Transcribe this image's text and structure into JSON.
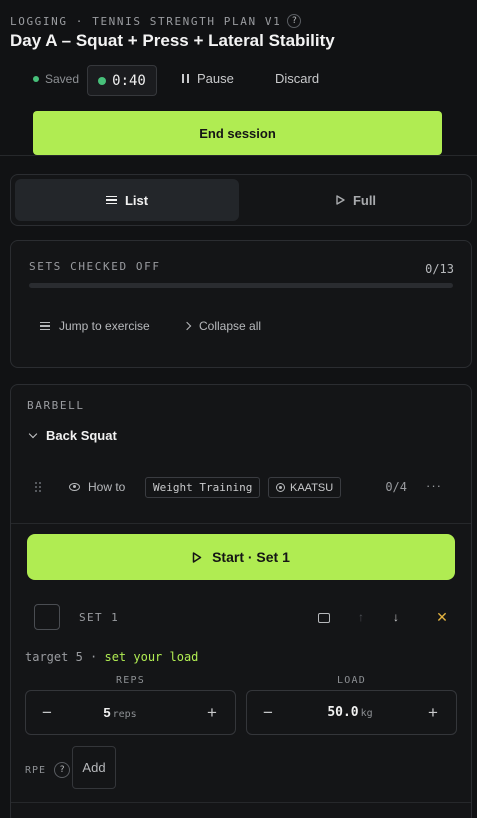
{
  "header": {
    "kicker": "LOGGING · TENNIS STRENGTH PLAN V1",
    "help": "?",
    "title": "Day A – Squat + Press + Lateral Stability"
  },
  "session": {
    "saved_label": "Saved",
    "timer": "0:40",
    "pause_label": "Pause",
    "discard_label": "Discard",
    "end_label": "End session"
  },
  "view_toggle": {
    "list_label": "List",
    "full_label": "Full",
    "active": "List"
  },
  "progress": {
    "label": "SETS CHECKED OFF",
    "count": "0/13",
    "fraction": 0,
    "jump_label": "Jump to exercise",
    "collapse_label": "Collapse all"
  },
  "exercise": {
    "group": "BARBELL",
    "name": "Back Squat",
    "howto_label": "How to",
    "tag_primary": "Weight Training",
    "tag_secondary": "KAATSU",
    "count": "0/4",
    "more": "···",
    "start_label": "Start · Set 1",
    "set": {
      "label": "SET 1",
      "target_prefix": "target 5 · ",
      "target_hint": "set your load",
      "reps_label": "REPS",
      "reps_value": "5",
      "reps_unit": "reps",
      "load_label": "LOAD",
      "load_value": "50.0",
      "load_unit": "kg",
      "minus": "−",
      "plus": "+",
      "rpe_label": "RPE",
      "rpe_help": "?",
      "rpe_add": "Add"
    }
  },
  "colors": {
    "accent": "#b0ec52",
    "background": "#111214",
    "saved_dot": "#47c07a",
    "warn": "#e3b341"
  }
}
